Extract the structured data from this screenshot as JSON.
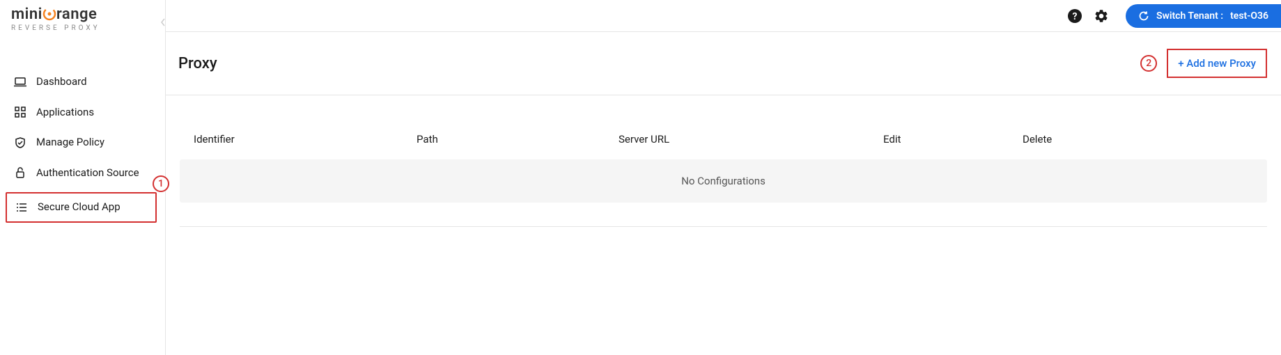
{
  "logo": {
    "prefix": "mini",
    "accent": "O",
    "suffix": "range",
    "subtitle": "REVERSE PROXY"
  },
  "sidebar": {
    "items": [
      {
        "label": "Dashboard"
      },
      {
        "label": "Applications"
      },
      {
        "label": "Manage Policy"
      },
      {
        "label": "Authentication Source"
      },
      {
        "label": "Secure Cloud App"
      }
    ]
  },
  "topbar": {
    "switch_label": "Switch Tenant :",
    "tenant": "test-O36"
  },
  "page": {
    "title": "Proxy",
    "add_button": "+ Add new Proxy"
  },
  "table": {
    "headers": {
      "identifier": "Identifier",
      "path": "Path",
      "server_url": "Server URL",
      "edit": "Edit",
      "delete": "Delete"
    },
    "empty_message": "No Configurations"
  },
  "annotations": {
    "a1": "1",
    "a2": "2"
  }
}
